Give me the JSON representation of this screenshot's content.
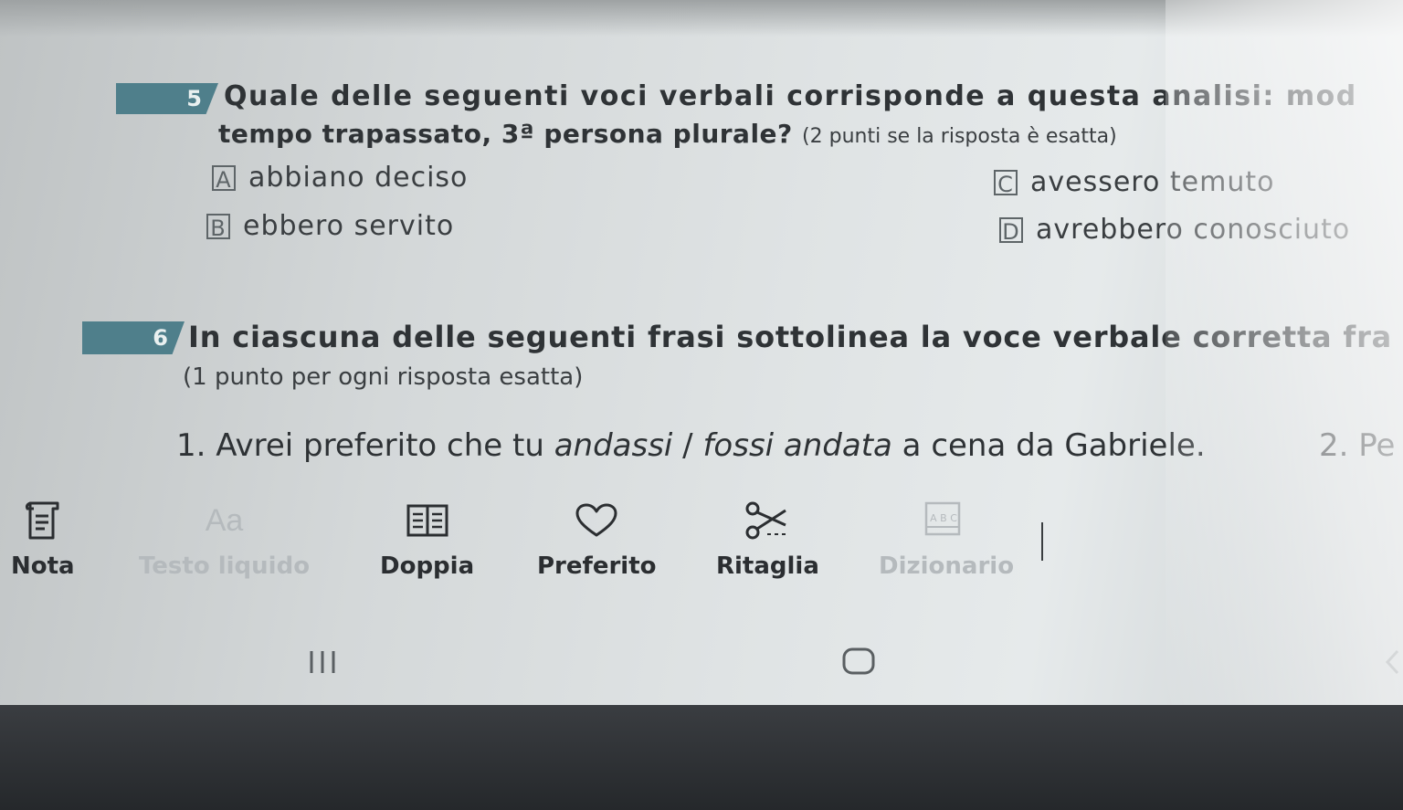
{
  "q5": {
    "number": "5",
    "line1": "Quale delle seguenti voci verbali corrisponde a questa analisi: mod",
    "line2_bold": "tempo trapassato, 3ª persona plurale?",
    "line2_note": "(2 punti se la risposta è esatta)",
    "options": [
      {
        "letter": "A",
        "text": "abbiano deciso"
      },
      {
        "letter": "B",
        "text": "ebbero servito"
      },
      {
        "letter": "C",
        "text": "avessero temuto"
      },
      {
        "letter": "D",
        "text": "avrebbero conosciuto"
      }
    ]
  },
  "q6": {
    "number": "6",
    "line1": "In ciascuna delle seguenti frasi sottolinea la voce verbale corretta fra",
    "note": "(1 punto per ogni risposta esatta)",
    "sentence1": {
      "start": "1. Avrei preferito che tu ",
      "italic1": "andassi",
      "sep": " / ",
      "italic2": "fossi andata",
      "end": " a cena da Gabriele."
    },
    "sentence2_start": "2. Pe"
  },
  "toolbar": {
    "items": [
      {
        "label": "Nota",
        "icon": "note-icon",
        "enabled": true
      },
      {
        "label": "Testo liquido",
        "icon": "text-aa-icon",
        "enabled": false
      },
      {
        "label": "Doppia",
        "icon": "double-page-icon",
        "enabled": true
      },
      {
        "label": "Preferito",
        "icon": "heart-icon",
        "enabled": true
      },
      {
        "label": "Ritaglia",
        "icon": "scissors-icon",
        "enabled": true
      },
      {
        "label": "Dizionario",
        "icon": "dictionary-icon",
        "enabled": false
      }
    ],
    "aa_glyph": "Aa",
    "dict_glyph": "A B C"
  },
  "navbar": {
    "recents_icon": "recents-icon",
    "home_icon": "home-icon",
    "back_icon": "back-icon"
  },
  "colors": {
    "badge": "#4f7f8b",
    "text": "#2f3336",
    "disabled": "#b5babd",
    "bezel": "#2a2d31"
  }
}
